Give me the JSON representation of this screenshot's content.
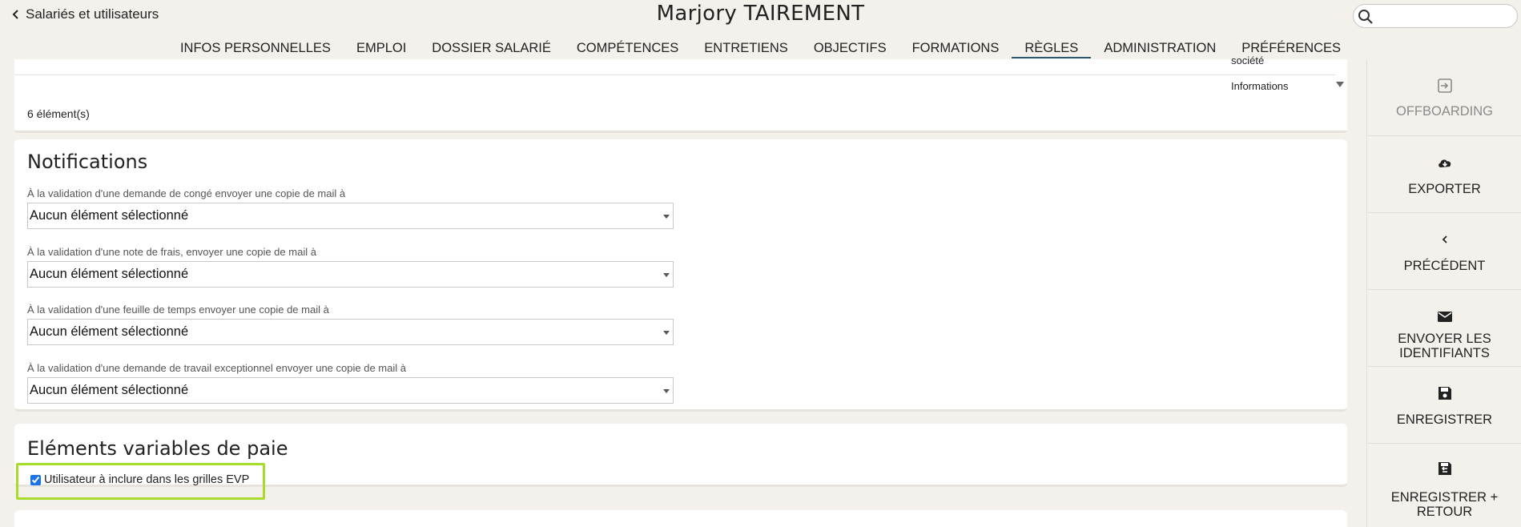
{
  "header": {
    "back_label": "Salariés et utilisateurs",
    "title": "Marjory TAIREMENT",
    "search_placeholder": ""
  },
  "tabs": [
    {
      "label": "INFOS PERSONNELLES"
    },
    {
      "label": "EMPLOI"
    },
    {
      "label": "DOSSIER SALARIÉ"
    },
    {
      "label": "COMPÉTENCES"
    },
    {
      "label": "ENTRETIENS"
    },
    {
      "label": "OBJECTIFS"
    },
    {
      "label": "FORMATIONS"
    },
    {
      "label": "RÈGLES",
      "active": true
    },
    {
      "label": "ADMINISTRATION"
    },
    {
      "label": "PRÉFÉRENCES"
    }
  ],
  "top_table": {
    "cell_1": "société",
    "cell_2": "Informations",
    "count": "6 élément(s)"
  },
  "notifications": {
    "title": "Notifications",
    "fields": [
      {
        "label": "À la validation d'une demande de congé envoyer une copie de mail à",
        "value": "Aucun élément sélectionné"
      },
      {
        "label": "À la validation d'une note de frais, envoyer une copie de mail à",
        "value": "Aucun élément sélectionné"
      },
      {
        "label": "À la validation d'une feuille de temps envoyer une copie de mail à",
        "value": "Aucun élément sélectionné"
      },
      {
        "label": "À la validation d'une demande de travail exceptionnel envoyer une copie de mail à",
        "value": "Aucun élément sélectionné"
      }
    ]
  },
  "evp": {
    "title": "Eléments variables de paie",
    "checkbox_label": "Utilisateur à inclure dans les grilles EVP",
    "checked": true,
    "highlight_color": "#a8dc2a"
  },
  "actions": [
    {
      "label": "OFFBOARDING",
      "icon": "offboarding-icon",
      "disabled": true
    },
    {
      "label": "EXPORTER",
      "icon": "cloud-download-icon"
    },
    {
      "label": "PRÉCÉDENT",
      "icon": "chevron-left-icon"
    },
    {
      "label_line1": "ENVOYER LES",
      "label_line2": "IDENTIFIANTS",
      "icon": "mail-icon"
    },
    {
      "label": "ENREGISTRER",
      "icon": "save-icon"
    },
    {
      "label_line1": "ENREGISTRER +",
      "label_line2": "RETOUR",
      "icon": "save-return-icon"
    }
  ],
  "colors": {
    "background": "#f4f1ec",
    "active_tab_underline": "#2a5a72"
  }
}
